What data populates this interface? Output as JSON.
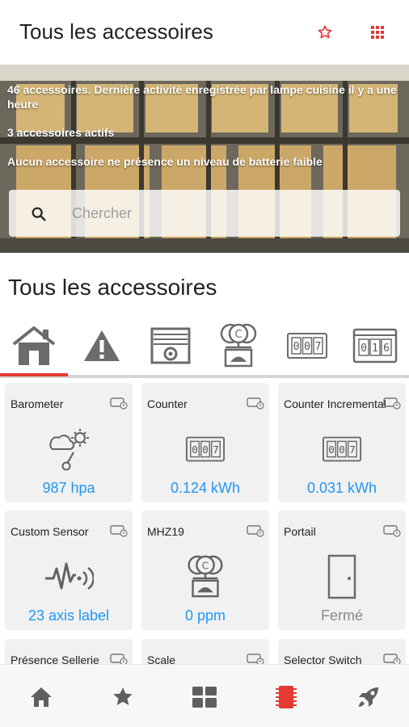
{
  "appbar": {
    "title": "Tous les accessoires",
    "star_icon": "star-outline-icon",
    "grid_icon": "apps-grid-icon",
    "accent": "#e53935"
  },
  "hero": {
    "info_line1": "46 accessoires. Dernière activité enregistrée par lampe cuisine il y a une heure",
    "info_line2": "3 accessoires actifs",
    "info_line3": "Aucun accessoire ne présence un niveau de batterie faible",
    "search_placeholder": "Chercher",
    "search_value": ""
  },
  "section": {
    "title": "Tous les accessoires"
  },
  "tabs": [
    {
      "icon": "house-icon",
      "selected": true
    },
    {
      "icon": "warning-icon",
      "selected": false
    },
    {
      "icon": "window-shutter-icon",
      "selected": false
    },
    {
      "icon": "scale-icon",
      "selected": false
    },
    {
      "icon": "counter-icon",
      "selected": false
    },
    {
      "icon": "counter-display-icon",
      "selected": false
    }
  ],
  "cards": [
    {
      "name": "Barometer",
      "icon": "barometer-icon",
      "value": "987 hpa",
      "state": "on"
    },
    {
      "name": "Counter",
      "icon": "counter-icon",
      "value": "0.124 kWh",
      "state": "on"
    },
    {
      "name": "Counter Incremental",
      "icon": "counter-icon",
      "value": "0.031 kWh",
      "state": "on"
    },
    {
      "name": "Custom Sensor",
      "icon": "sensor-wave-icon",
      "value": "23 axis label",
      "state": "on"
    },
    {
      "name": "MHZ19",
      "icon": "scale-icon",
      "value": "0 ppm",
      "state": "on"
    },
    {
      "name": "Portail",
      "icon": "door-icon",
      "value": "Fermé",
      "state": "off"
    },
    {
      "name": "Présence Sellerie",
      "icon": "",
      "value": "",
      "state": "on"
    },
    {
      "name": "Scale",
      "icon": "",
      "value": "",
      "state": "on"
    },
    {
      "name": "Selector Switch",
      "icon": "",
      "value": "",
      "state": "on"
    }
  ],
  "bottom_nav": [
    {
      "icon": "home-icon",
      "active": false
    },
    {
      "icon": "star-icon",
      "active": false
    },
    {
      "icon": "dashboard-grid-icon",
      "active": false
    },
    {
      "icon": "chip-icon",
      "active": true
    },
    {
      "icon": "rocket-icon",
      "active": false
    }
  ],
  "colors": {
    "value_blue": "#2196f3",
    "accent_red": "#e53935",
    "card_bg": "#f1f1f1",
    "icon_gray": "#5f6368"
  }
}
